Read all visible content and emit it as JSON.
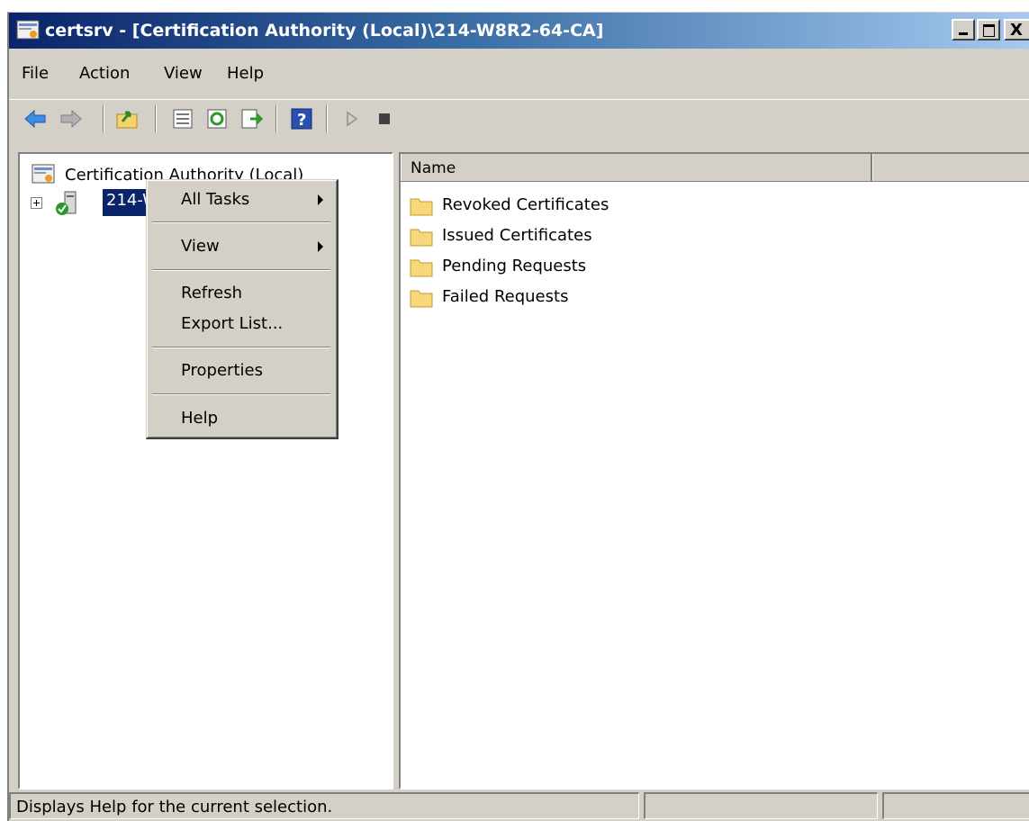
{
  "window": {
    "title": "certsrv - [Certification Authority (Local)\\214-W8R2-64-CA]",
    "controls": {
      "minimize": "_",
      "maximize": "□",
      "close": "X"
    }
  },
  "menubar": {
    "items": [
      {
        "label": "File"
      },
      {
        "label": "Action"
      },
      {
        "label": "View"
      },
      {
        "label": "Help"
      }
    ]
  },
  "toolbar": {
    "icons": [
      "back-arrow-icon",
      "forward-arrow-icon",
      "up-folder-icon",
      "show-hide-tree-icon",
      "refresh-icon",
      "export-list-icon",
      "help-icon",
      "start-service-icon",
      "stop-service-icon"
    ]
  },
  "tree": {
    "root_label": "Certification Authority (Local)",
    "node_label": "214-W8R2-64-CA",
    "node_visible_label": "214-W"
  },
  "list": {
    "columns": [
      {
        "label": "Name"
      },
      {
        "label": ""
      }
    ],
    "items": [
      {
        "label": "Revoked Certificates"
      },
      {
        "label": "Issued Certificates"
      },
      {
        "label": "Pending Requests"
      },
      {
        "label": "Failed Requests"
      }
    ]
  },
  "context_menu": {
    "all_tasks": "All Tasks",
    "view": "View",
    "refresh": "Refresh",
    "export_list": "Export List...",
    "properties": "Properties",
    "help": "Help"
  },
  "statusbar": {
    "message": "Displays Help for the current selection.",
    "cell2": "",
    "cell3": ""
  },
  "colors": {
    "titlebar_start": "#0a246a",
    "titlebar_end": "#a6caf0",
    "selection": "#0a246a",
    "chrome": "#d4d0c8"
  }
}
